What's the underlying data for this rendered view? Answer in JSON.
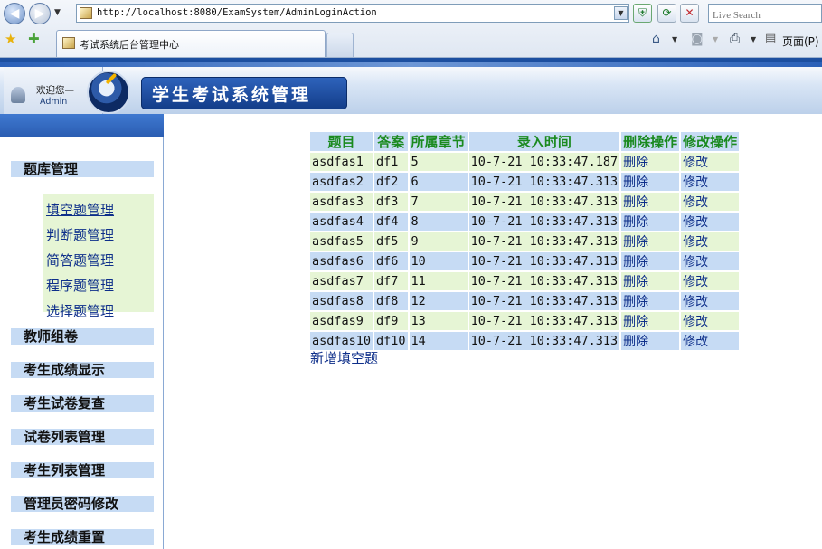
{
  "browser": {
    "address": "http://localhost:8080/ExamSystem/AdminLoginAction",
    "search_placeholder": "Live Search",
    "tab_title": "考试系统后台管理中心",
    "page_menu_label": "页面(P)"
  },
  "header": {
    "welcome": "欢迎您—",
    "user": "Admin",
    "title": "学生考试系统管理"
  },
  "sidebar": {
    "group_title": "题库管理",
    "sub_items": [
      "填空题管理",
      "判断题管理",
      "简答题管理",
      "程序题管理",
      "选择题管理"
    ],
    "menu": [
      "教师组卷",
      "考生成绩显示",
      "考生试卷复查",
      "试卷列表管理",
      "考生列表管理",
      "管理员密码修改",
      "考生成绩重置"
    ]
  },
  "table": {
    "headers": [
      "题目",
      "答案",
      "所属章节",
      "录入时间",
      "删除操作",
      "修改操作"
    ],
    "rows": [
      {
        "title": "asdfas1",
        "answer": "df1",
        "chapter": "5",
        "time": "10-7-21 10:33:47.187",
        "delete": "删除",
        "edit": "修改"
      },
      {
        "title": "asdfas2",
        "answer": "df2",
        "chapter": "6",
        "time": "10-7-21 10:33:47.313",
        "delete": "删除",
        "edit": "修改"
      },
      {
        "title": "asdfas3",
        "answer": "df3",
        "chapter": "7",
        "time": "10-7-21 10:33:47.313",
        "delete": "删除",
        "edit": "修改"
      },
      {
        "title": "asdfas4",
        "answer": "df4",
        "chapter": "8",
        "time": "10-7-21 10:33:47.313",
        "delete": "删除",
        "edit": "修改"
      },
      {
        "title": "asdfas5",
        "answer": "df5",
        "chapter": "9",
        "time": "10-7-21 10:33:47.313",
        "delete": "删除",
        "edit": "修改"
      },
      {
        "title": "asdfas6",
        "answer": "df6",
        "chapter": "10",
        "time": "10-7-21 10:33:47.313",
        "delete": "删除",
        "edit": "修改"
      },
      {
        "title": "asdfas7",
        "answer": "df7",
        "chapter": "11",
        "time": "10-7-21 10:33:47.313",
        "delete": "删除",
        "edit": "修改"
      },
      {
        "title": "asdfas8",
        "answer": "df8",
        "chapter": "12",
        "time": "10-7-21 10:33:47.313",
        "delete": "删除",
        "edit": "修改"
      },
      {
        "title": "asdfas9",
        "answer": "df9",
        "chapter": "13",
        "time": "10-7-21 10:33:47.313",
        "delete": "删除",
        "edit": "修改"
      },
      {
        "title": "asdfas10",
        "answer": "df10",
        "chapter": "14",
        "time": "10-7-21 10:33:47.313",
        "delete": "删除",
        "edit": "修改"
      }
    ],
    "add_link": "新增填空题"
  },
  "colors": {
    "header_text": "#1a8a1f",
    "row_blue": "#c6dbf4",
    "row_green": "#e6f5d5",
    "link": "#0e2f8a",
    "title_bar": "#1c4fa0"
  },
  "icons": [
    "back-arrow-icon",
    "forward-arrow-icon",
    "page-icon",
    "shield-icon",
    "refresh-icon",
    "stop-icon",
    "favorites-star-icon",
    "add-favorites-icon",
    "home-icon",
    "feeds-icon",
    "print-icon",
    "page-menu-icon",
    "user-icon",
    "app-logo-icon"
  ]
}
